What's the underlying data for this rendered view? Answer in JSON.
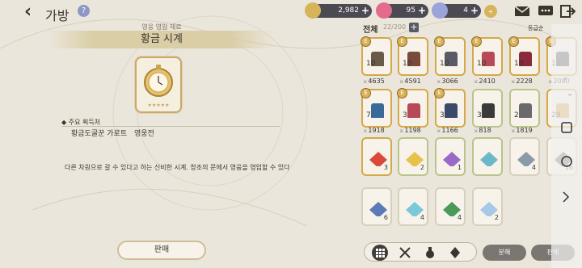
{
  "header": {
    "title": "가방",
    "help": "?"
  },
  "currencies": [
    {
      "name": "gold",
      "value": "2,982",
      "plus": "+",
      "color": "#d6b45a"
    },
    {
      "name": "gem",
      "value": "95",
      "plus": "+",
      "color": "#e36b8d"
    },
    {
      "name": "crystal",
      "value": "4",
      "plus": "+",
      "color": "#9aa4d8"
    }
  ],
  "left": {
    "category": "영웅 영입 재료",
    "item_name": "황금 시계",
    "acquire_title": "주요 획득처",
    "acquire": [
      "황금도굴꾼 가로트",
      "영웅전"
    ],
    "description": "다른 차원으로 갈 수 있다고 하는 신비한 시계. 창조의 문에서 영웅을 영입할 수 있다",
    "sell_label": "판매"
  },
  "right": {
    "header": "전체",
    "count": "22/200",
    "add": "+",
    "sort": "등급순",
    "items": [
      {
        "badge": "E",
        "cap": "4635",
        "cnt": "10",
        "frame": "gold"
      },
      {
        "badge": "E",
        "cap": "4591",
        "cnt": "10",
        "frame": "gold"
      },
      {
        "badge": "E",
        "cap": "3066",
        "cnt": "10",
        "frame": "gold"
      },
      {
        "badge": "E",
        "cap": "2410",
        "cnt": "10",
        "frame": "gold"
      },
      {
        "badge": "E",
        "cap": "2228",
        "cnt": "10",
        "frame": "gold"
      },
      {
        "badge": "E",
        "cap": "2080",
        "cnt": "10",
        "frame": "gold"
      },
      {
        "badge": "E",
        "cap": "1918",
        "cnt": "7",
        "frame": "gold"
      },
      {
        "badge": "E",
        "cap": "1198",
        "cnt": "3",
        "frame": "gold"
      },
      {
        "badge": "E",
        "cap": "1166",
        "cnt": "3",
        "frame": "gold"
      },
      {
        "badge": "",
        "cap": "818",
        "cnt": "3",
        "frame": "green"
      },
      {
        "badge": "",
        "cap": "1819",
        "cnt": "2",
        "frame": "green"
      },
      {
        "badge": "",
        "cap": "",
        "cnt": "29",
        "frame": "gold"
      },
      {
        "badge": "",
        "qty": "3",
        "frame": "gold"
      },
      {
        "badge": "",
        "qty": "2",
        "frame": "green"
      },
      {
        "badge": "",
        "qty": "1",
        "frame": "green"
      },
      {
        "badge": "",
        "qty": "",
        "frame": "green"
      },
      {
        "badge": "",
        "qty": "4",
        "frame": "plain"
      },
      {
        "badge": "",
        "qty": "16",
        "frame": "plain"
      },
      {
        "badge": "",
        "qty": "6",
        "frame": "plain"
      },
      {
        "badge": "",
        "qty": "4",
        "frame": "plain"
      },
      {
        "badge": "",
        "qty": "4",
        "frame": "plain"
      },
      {
        "badge": "",
        "qty": "2",
        "frame": "plain"
      }
    ],
    "tabs": [
      "all-tab",
      "weapon-tab",
      "potion-tab",
      "material-tab"
    ],
    "dismantle": "분해",
    "sell": "판매"
  }
}
